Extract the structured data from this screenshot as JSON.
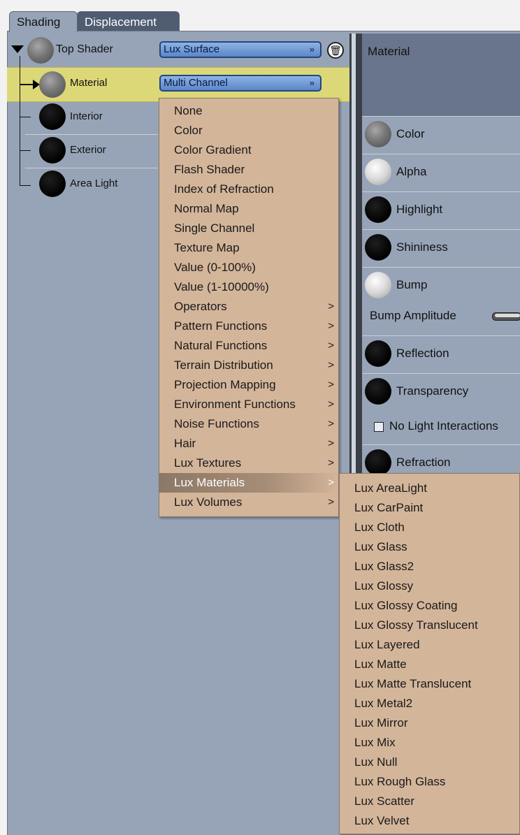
{
  "tabs": {
    "shading": "Shading",
    "displacement": "Displacement"
  },
  "tree": {
    "top_shader": "Top Shader",
    "material": "Material",
    "interior": "Interior",
    "exterior": "Exterior",
    "area_light": "Area Light",
    "top_dropdown": "Lux Surface",
    "material_dropdown": "Multi Channel"
  },
  "right_panel": {
    "header": "Material",
    "channels": {
      "color": "Color",
      "alpha": "Alpha",
      "highlight": "Highlight",
      "shininess": "Shininess",
      "bump": "Bump",
      "reflection": "Reflection",
      "transparency": "Transparency",
      "refraction": "Refraction"
    },
    "bump_amplitude": "Bump Amplitude",
    "no_light_interactions": "No Light Interactions"
  },
  "menu": {
    "items": [
      {
        "label": "None",
        "sub": false
      },
      {
        "label": "Color",
        "sub": false
      },
      {
        "label": "Color Gradient",
        "sub": false
      },
      {
        "label": "Flash Shader",
        "sub": false
      },
      {
        "label": "Index of Refraction",
        "sub": false
      },
      {
        "label": "Normal Map",
        "sub": false
      },
      {
        "label": "Single Channel",
        "sub": false
      },
      {
        "label": "Texture Map",
        "sub": false
      },
      {
        "label": "Value (0-100%)",
        "sub": false
      },
      {
        "label": "Value (1-10000%)",
        "sub": false
      },
      {
        "label": "Operators",
        "sub": true
      },
      {
        "label": "Pattern Functions",
        "sub": true
      },
      {
        "label": "Natural Functions",
        "sub": true
      },
      {
        "label": "Terrain Distribution",
        "sub": true
      },
      {
        "label": "Projection Mapping",
        "sub": true
      },
      {
        "label": "Environment Functions",
        "sub": true
      },
      {
        "label": "Noise Functions",
        "sub": true
      },
      {
        "label": "Hair",
        "sub": true
      },
      {
        "label": "Lux Textures",
        "sub": true
      },
      {
        "label": "Lux Materials",
        "sub": true
      },
      {
        "label": "Lux Volumes",
        "sub": true
      }
    ],
    "arrow": ">",
    "highlighted": "Lux Materials"
  },
  "submenu": {
    "items": [
      "Lux AreaLight",
      "Lux CarPaint",
      "Lux Cloth",
      "Lux Glass",
      "Lux Glass2",
      "Lux Glossy",
      "Lux Glossy Coating",
      "Lux Glossy Translucent",
      "Lux Layered",
      "Lux Matte",
      "Lux Matte Translucent",
      "Lux Metal2",
      "Lux Mirror",
      "Lux Mix",
      "Lux Null",
      "Lux Rough Glass",
      "Lux Scatter",
      "Lux Velvet"
    ]
  },
  "icons": {
    "trash": "trash-icon",
    "chevron": "double-chevron-icon",
    "arrow": "arrow-right-icon"
  },
  "colors": {
    "panel": "#97a4b7",
    "header": "#68758c",
    "menu": "#d3b59a",
    "selection": "#dcd878",
    "dropdown": "#6f97d6"
  }
}
